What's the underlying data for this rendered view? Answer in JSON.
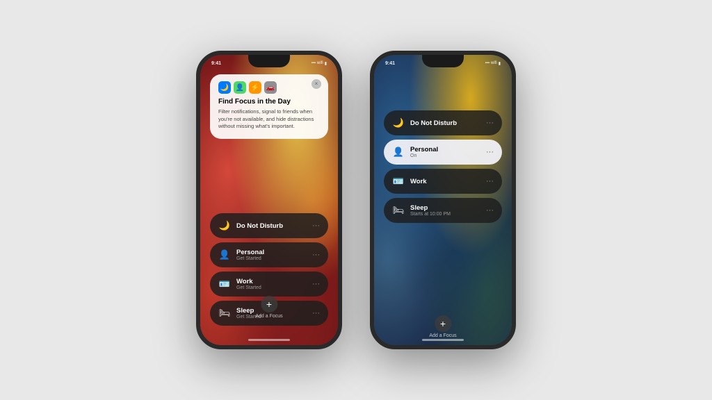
{
  "page": {
    "background": "#e0e0e0"
  },
  "phone1": {
    "status_time": "9:41",
    "popup": {
      "title": "Find Focus in the Day",
      "text": "Filter notifications, signal to friends when you're not available, and hide distractions without missing what's important.",
      "close": "×",
      "icons": [
        "🌙",
        "⚡",
        "👤",
        "🚗"
      ]
    },
    "items": [
      {
        "icon": "🌙",
        "label": "Do Not Disturb",
        "sub": "",
        "more": "···",
        "active": false
      },
      {
        "icon": "👤",
        "label": "Personal",
        "sub": "Get Started",
        "more": "···",
        "active": false
      },
      {
        "icon": "🪪",
        "label": "Work",
        "sub": "Get Started",
        "more": "···",
        "active": false
      },
      {
        "icon": "🛏",
        "label": "Sleep",
        "sub": "Get Started",
        "more": "···",
        "active": false
      }
    ],
    "add_label": "Add a Focus"
  },
  "phone2": {
    "status_time": "9:41",
    "items": [
      {
        "icon": "🌙",
        "label": "Do Not Disturb",
        "sub": "",
        "more": "···",
        "active": false
      },
      {
        "icon": "👤",
        "label": "Personal",
        "sub": "On",
        "more": "···",
        "active": true
      },
      {
        "icon": "🪪",
        "label": "Work",
        "sub": "",
        "more": "···",
        "active": false
      },
      {
        "icon": "🛏",
        "label": "Sleep",
        "sub": "Starts at 10:00 PM",
        "more": "···",
        "active": false
      }
    ],
    "add_label": "Add a Focus"
  }
}
